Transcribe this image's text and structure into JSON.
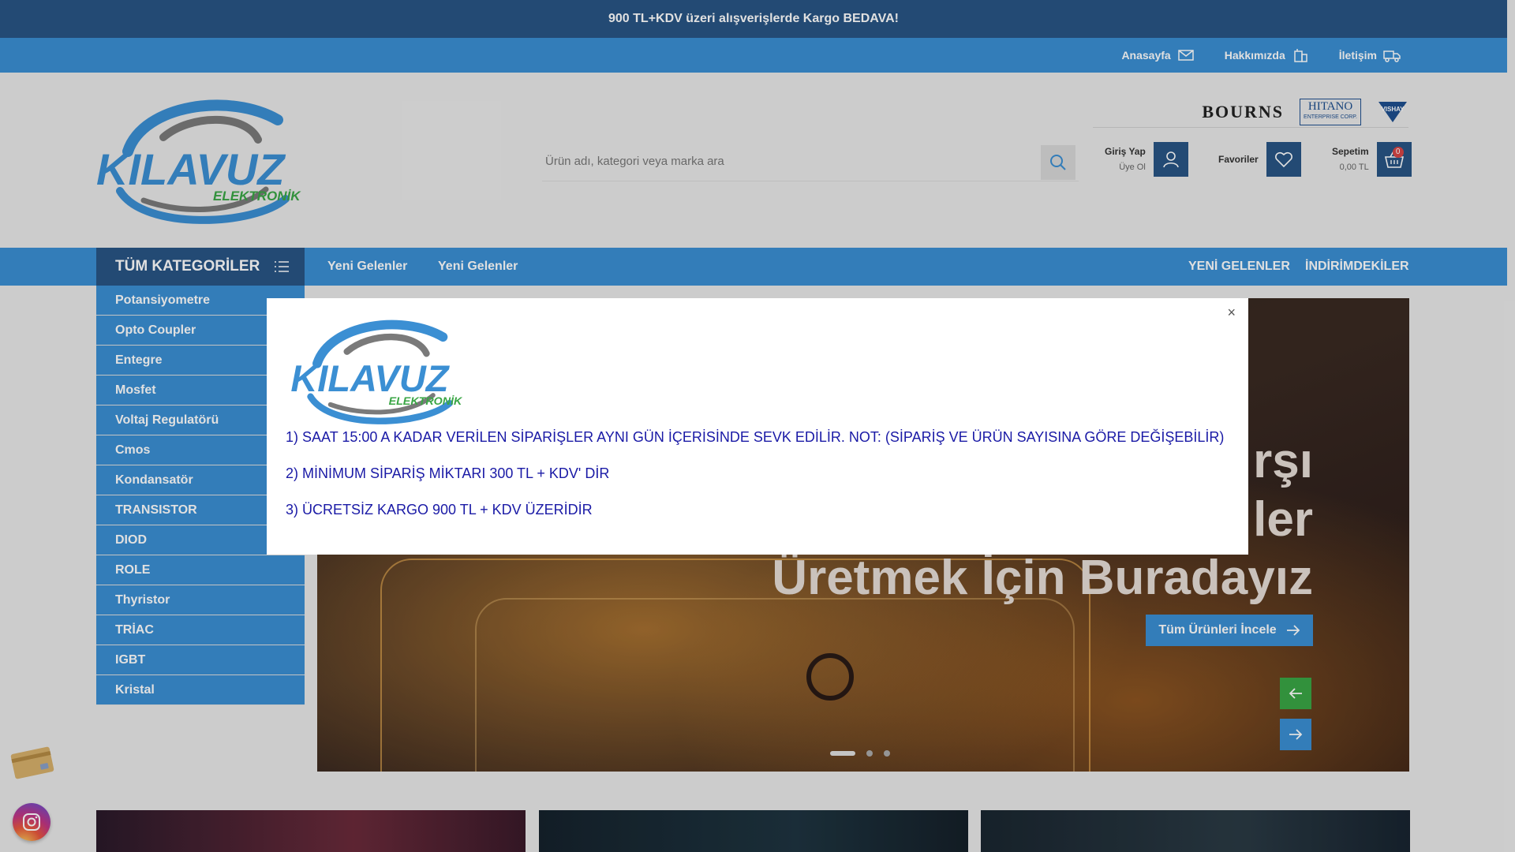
{
  "topbar": {
    "text": "900 TL+KDV üzeri alışverişlerde Kargo BEDAVA!"
  },
  "subnav": [
    {
      "label": "Anasayfa",
      "icon": "mail-icon"
    },
    {
      "label": "Hakkımızda",
      "icon": "building-icon"
    },
    {
      "label": "İletişim",
      "icon": "truck-icon"
    }
  ],
  "logo": {
    "main": "KILAVUZ",
    "sub": "ELEKTRONİK"
  },
  "search": {
    "placeholder": "Ürün adı, kategori veya marka ara"
  },
  "brands": {
    "bourns": "BOURNS",
    "hitano": "HITANO",
    "hitano_sub": "ENTERPRISE CORP.",
    "vishay": "VISHAY"
  },
  "account": {
    "login": "Giriş Yap",
    "register": "Üye Ol"
  },
  "favorites": {
    "label": "Favoriler"
  },
  "cart": {
    "label": "Sepetim",
    "total": "0,00 TL",
    "count": "0"
  },
  "nav": {
    "all_categories": "TÜM KATEGORİLER",
    "links": [
      "Yeni Gelenler",
      "Yeni Gelenler"
    ],
    "right_links": [
      "YENİ GELENLER",
      "İNDİRİMDEKİLER"
    ]
  },
  "categories": [
    "Potansiyometre",
    "Opto Coupler",
    "Entegre",
    "Mosfet",
    "Voltaj Regulatörü",
    "Cmos",
    "Kondansatör",
    "TRANSISTOR",
    "DIOD",
    "ROLE",
    "Thyristor",
    "TRİAC",
    "IGBT",
    "Kristal"
  ],
  "slider": {
    "title_lines": [
      "rşı",
      "ler",
      "Üretmek İçin Buradayız"
    ],
    "button": "Tüm Ürünleri İncele"
  },
  "modal": {
    "close": "×",
    "lines": [
      "1) SAAT 15:00 A KADAR VERİLEN SİPARİŞLER AYNI GÜN İÇERİSİNDE SEVK EDİLİR. NOT: (SİPARİŞ VE ÜRÜN SAYISINA GÖRE DEĞİŞEBİLİR)",
      "2) MİNİMUM SİPARİŞ MİKTARI 300 TL + KDV' DİR",
      "3) ÜCRETSİZ KARGO 900 TL  + KDV ÜZERİDİR"
    ]
  },
  "colors": {
    "dark_blue": "#285585",
    "blue": "#3b8fd3",
    "green_arrow": "#3aa645",
    "modal_text": "#1a1aa6"
  }
}
